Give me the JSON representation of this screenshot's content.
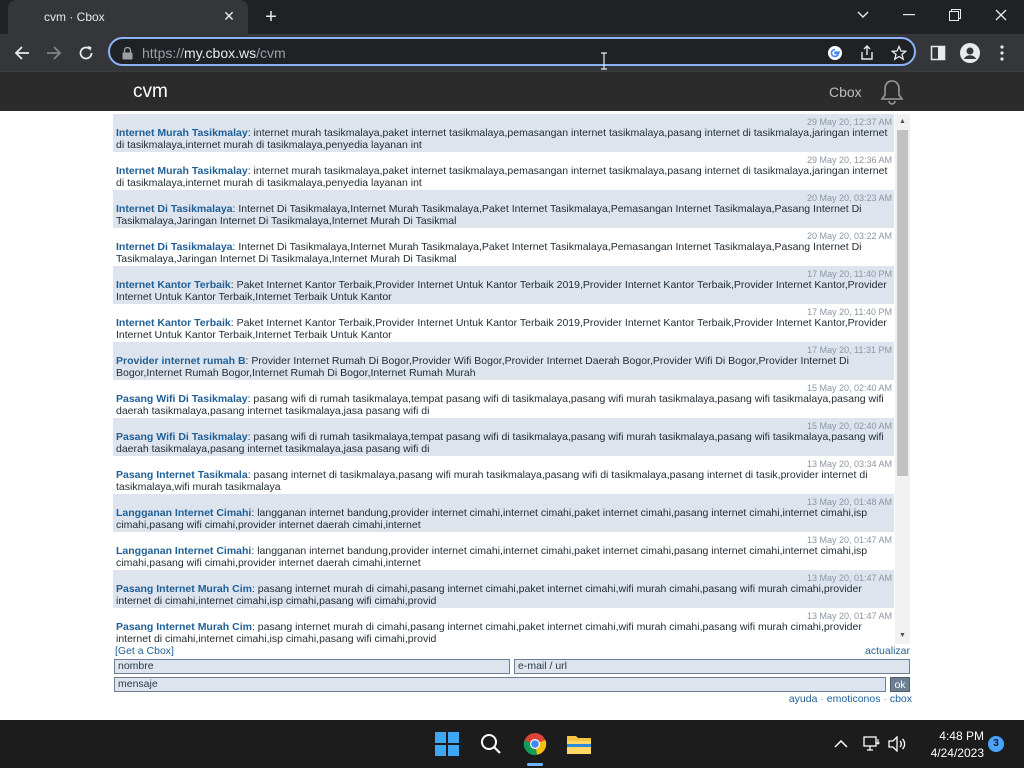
{
  "browser": {
    "tab_title": "cvm · Cbox",
    "url_scheme": "https://",
    "url_host": "my.cbox.ws",
    "url_path": "/cvm"
  },
  "site": {
    "title": "cvm",
    "cbox_link": "Cbox"
  },
  "messages": [
    {
      "time": "29 May 20, 12:37 AM",
      "name": "Internet Murah Tasikmalay",
      "text": ": internet murah tasikmalaya,paket internet tasikmalaya,pemasangan internet tasikmalaya,pasang internet di tasikmalaya,jaringan internet di tasikmalaya,internet murah di tasikmalaya,penyedia layanan int"
    },
    {
      "time": "29 May 20, 12:36 AM",
      "name": "Internet Murah Tasikmalay",
      "text": ": internet murah tasikmalaya,paket internet tasikmalaya,pemasangan internet tasikmalaya,pasang internet di tasikmalaya,jaringan internet di tasikmalaya,internet murah di tasikmalaya,penyedia layanan int"
    },
    {
      "time": "20 May 20, 03:23 AM",
      "name": "Internet Di Tasikmalaya",
      "text": ": Internet Di Tasikmalaya,Internet Murah Tasikmalaya,Paket Internet Tasikmalaya,Pemasangan Internet Tasikmalaya,Pasang Internet Di Tasikmalaya,Jaringan Internet Di Tasikmalaya,Internet Murah Di Tasikmal"
    },
    {
      "time": "20 May 20, 03:22 AM",
      "name": "Internet Di Tasikmalaya",
      "text": ": Internet Di Tasikmalaya,Internet Murah Tasikmalaya,Paket Internet Tasikmalaya,Pemasangan Internet Tasikmalaya,Pasang Internet Di Tasikmalaya,Jaringan Internet Di Tasikmalaya,Internet Murah Di Tasikmal"
    },
    {
      "time": "17 May 20, 11:40 PM",
      "name": "Internet Kantor Terbaik",
      "text": ": Paket Internet Kantor Terbaik,Provider Internet Untuk Kantor Terbaik 2019,Provider Internet Kantor Terbaik,Provider Internet Kantor,Provider Internet Untuk Kantor Terbaik,Internet Terbaik Untuk Kantor"
    },
    {
      "time": "17 May 20, 11:40 PM",
      "name": "Internet Kantor Terbaik",
      "text": ": Paket Internet Kantor Terbaik,Provider Internet Untuk Kantor Terbaik 2019,Provider Internet Kantor Terbaik,Provider Internet Kantor,Provider Internet Untuk Kantor Terbaik,Internet Terbaik Untuk Kantor"
    },
    {
      "time": "17 May 20, 11:31 PM",
      "name": "Provider internet rumah B",
      "text": ": Provider Internet Rumah Di Bogor,Provider Wifi Bogor,Provider Internet Daerah Bogor,Provider Wifi Di Bogor,Provider Internet Di Bogor,Internet Rumah Bogor,Internet Rumah Di Bogor,Internet Rumah Murah"
    },
    {
      "time": "15 May 20, 02:40 AM",
      "name": "Pasang Wifi Di Tasikmalay",
      "text": ": pasang wifi di rumah tasikmalaya,tempat pasang wifi di tasikmalaya,pasang wifi murah tasikmalaya,pasang wifi tasikmalaya,pasang wifi daerah tasikmalaya,pasang internet tasikmalaya,jasa pasang wifi di"
    },
    {
      "time": "15 May 20, 02:40 AM",
      "name": "Pasang Wifi Di Tasikmalay",
      "text": ": pasang wifi di rumah tasikmalaya,tempat pasang wifi di tasikmalaya,pasang wifi murah tasikmalaya,pasang wifi tasikmalaya,pasang wifi daerah tasikmalaya,pasang internet tasikmalaya,jasa pasang wifi di"
    },
    {
      "time": "13 May 20, 03:34 AM",
      "name": "Pasang Internet Tasikmala",
      "text": ": pasang internet di tasikmalaya,pasang wifi murah tasikmalaya,pasang wifi di tasikmalaya,pasang internet di tasik,provider internet di tasikmalaya,wifi murah tasikmalaya"
    },
    {
      "time": "13 May 20, 01:48 AM",
      "name": "Langganan Internet Cimahi",
      "text": ": langganan internet bandung,provider internet cimahi,internet cimahi,paket internet cimahi,pasang internet cimahi,internet cimahi,isp cimahi,pasang wifi cimahi,provider internet daerah cimahi,internet"
    },
    {
      "time": "13 May 20, 01:47 AM",
      "name": "Langganan Internet Cimahi",
      "text": ": langganan internet bandung,provider internet cimahi,internet cimahi,paket internet cimahi,pasang internet cimahi,internet cimahi,isp cimahi,pasang wifi cimahi,provider internet daerah cimahi,internet"
    },
    {
      "time": "13 May 20, 01:47 AM",
      "name": "Pasang Internet Murah Cim",
      "text": ": pasang internet murah di cimahi,pasang internet cimahi,paket internet cimahi,wifi murah cimahi,pasang wifi murah cimahi,provider internet di cimahi,internet cimahi,isp cimahi,pasang wifi cimahi,provid"
    },
    {
      "time": "13 May 20, 01:47 AM",
      "name": "Pasang Internet Murah Cim",
      "text": ": pasang internet murah di cimahi,pasang internet cimahi,paket internet cimahi,wifi murah cimahi,pasang wifi murah cimahi,provider internet di cimahi,internet cimahi,isp cimahi,pasang wifi cimahi,provid"
    }
  ],
  "cbox": {
    "get_cbox": "[Get a Cbox]",
    "refresh": "actualizar",
    "name_placeholder": "nombre",
    "email_placeholder": "e-mail / url",
    "message_placeholder": "mensaje",
    "ok": "ok",
    "help": "ayuda",
    "emoticons": "emoticonos",
    "cbox": "cbox",
    "separator": "·"
  },
  "taskbar": {
    "time": "4:48 PM",
    "date": "4/24/2023",
    "notifications": "3"
  },
  "colors": {
    "accent": "#8ab4f8",
    "message_alt_bg": "#dde4ed",
    "name_link": "#1f5f97"
  }
}
